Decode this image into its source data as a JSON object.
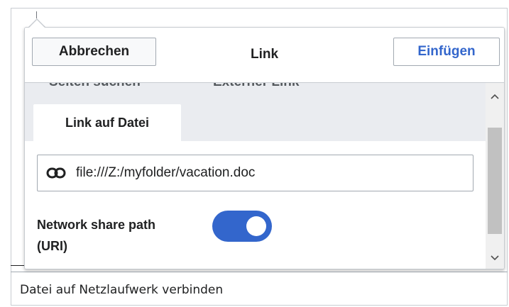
{
  "dialog": {
    "title": "Link",
    "cancel_label": "Abbrechen",
    "insert_label": "Einfügen"
  },
  "tabs": {
    "hidden_left": "Seiten suchen",
    "hidden_right": "Externer Link",
    "active": "Link auf Datei"
  },
  "link_field": {
    "icon": "link-icon",
    "value": "file:///Z:/myfolder/vacation.doc"
  },
  "network_share": {
    "label": "Network share path (URI)",
    "enabled": true
  },
  "caption": "Datei auf Netzlaufwerk verbinden",
  "colors": {
    "accent": "#3366cc",
    "border": "#a2a9b1",
    "tab_strip": "#eaecf0",
    "text": "#202122"
  }
}
